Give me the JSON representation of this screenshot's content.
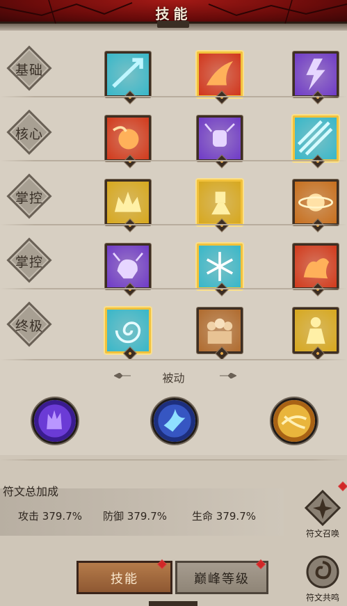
{
  "header": {
    "title": "技能"
  },
  "rows": [
    {
      "label": "基础",
      "skills": [
        {
          "icon": "ice-arrow-icon",
          "color": "#38b7c9",
          "selected": false
        },
        {
          "icon": "flame-arrow-icon",
          "color": "#d2361c",
          "selected": true
        },
        {
          "icon": "lightning-bolt-icon",
          "color": "#6f3bc7",
          "selected": false
        }
      ]
    },
    {
      "label": "核心",
      "skills": [
        {
          "icon": "fireball-icon",
          "color": "#d23a1c",
          "selected": false
        },
        {
          "icon": "lightning-fist-icon",
          "color": "#6f3bc7",
          "selected": false
        },
        {
          "icon": "ice-blades-icon",
          "color": "#38b7c9",
          "selected": true
        }
      ]
    },
    {
      "label": "掌控",
      "skills": [
        {
          "icon": "crown-burst-icon",
          "color": "#d7a81e",
          "selected": false
        },
        {
          "icon": "golden-figure-icon",
          "color": "#d7a81e",
          "selected": true
        },
        {
          "icon": "golden-planet-icon",
          "color": "#c76f1e",
          "selected": false
        }
      ]
    },
    {
      "label": "掌控",
      "skills": [
        {
          "icon": "storm-creature-icon",
          "color": "#6f3bc7",
          "selected": false
        },
        {
          "icon": "snowflake-icon",
          "color": "#38b7c9",
          "selected": true
        },
        {
          "icon": "fire-hydra-icon",
          "color": "#d23a1c",
          "selected": false
        }
      ]
    },
    {
      "label": "终极",
      "skills": [
        {
          "icon": "ice-vortex-icon",
          "color": "#38b7c9",
          "selected": true
        },
        {
          "icon": "summon-guards-icon",
          "color": "#b06b2e",
          "selected": false
        },
        {
          "icon": "golden-warrior-icon",
          "color": "#d7a81e",
          "selected": false
        }
      ]
    }
  ],
  "passive": {
    "title": "被动",
    "orbs": [
      {
        "icon": "violet-grasp-icon",
        "color": "#5b2ec7"
      },
      {
        "icon": "frost-bird-icon",
        "color": "#2b4fb8"
      },
      {
        "icon": "sun-orb-icon",
        "color": "#e1a32c"
      }
    ]
  },
  "rune": {
    "title": "符文总加成",
    "stats": [
      {
        "label": "攻击",
        "value": "379.7%"
      },
      {
        "label": "防御",
        "value": "379.7%"
      },
      {
        "label": "生命",
        "value": "379.7%"
      }
    ]
  },
  "side_buttons": {
    "rune_summon": "符文召唤",
    "rune_resonance": "符文共鸣"
  },
  "tabs": {
    "skills": "技能",
    "peak_level": "巅峰等级"
  }
}
